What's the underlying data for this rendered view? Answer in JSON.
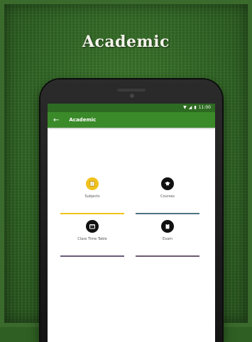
{
  "headline": "Academic",
  "status_bar": {
    "wifi_icon": "wifi-icon",
    "signal_icon": "signal-icon",
    "battery_icon": "battery-icon",
    "time": "11:00"
  },
  "app_bar": {
    "back_icon": "back-arrow-icon",
    "title": "Academic",
    "color": "#3b8a2a"
  },
  "tiles": [
    {
      "label": "Subjects",
      "icon": "book-icon",
      "color": "#f0c21d",
      "line_color": "#f0c21d"
    },
    {
      "label": "Courses",
      "icon": "graduation-cap-icon",
      "color": "#111111",
      "line_color": "#4f7481"
    },
    {
      "label": "Class Time Table",
      "icon": "calendar-icon",
      "color": "#111111",
      "line_color": "#6b5b7a"
    },
    {
      "label": "Exam",
      "icon": "clipboard-icon",
      "color": "#111111",
      "line_color": "#6b5b6e"
    }
  ]
}
